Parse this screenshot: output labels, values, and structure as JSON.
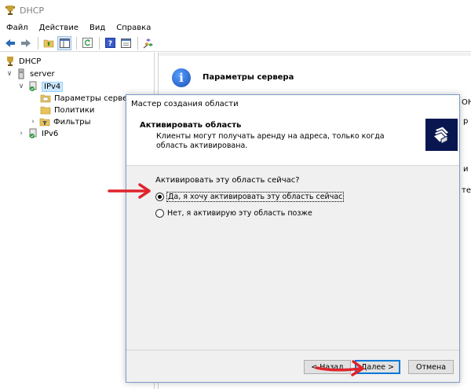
{
  "window": {
    "title": "DHCP",
    "icon": "dhcp-trophy-icon"
  },
  "menubar": {
    "items": [
      "Файл",
      "Действие",
      "Вид",
      "Справка"
    ]
  },
  "toolbar": {
    "buttons": [
      "back-arrow-icon",
      "forward-arrow-icon",
      "up-folder-icon",
      "show-hide-tree-icon",
      "refresh-icon",
      "help-icon",
      "properties-icon",
      "dhcp-action-icon"
    ]
  },
  "tree": {
    "root": "DHCP",
    "server": "server",
    "ipv4": "IPv4",
    "server_options": "Параметры сервера",
    "policies": "Политики",
    "filters": "Фильтры",
    "ipv6": "IPv6"
  },
  "right_pane": {
    "heading": "Параметры сервера",
    "clipped_1": "ОНС",
    "clipped_2": "р",
    "clipped_3": "и",
    "clipped_4": "те."
  },
  "wizard": {
    "title": "Мастер создания области",
    "header_title": "Активировать область",
    "header_desc": "Клиенты могут получать аренду на адреса, только когда область активирована.",
    "question": "Активировать эту область сейчас?",
    "option_yes": "Да, я хочу активировать эту область сейчас",
    "option_no": "Нет, я активирую эту область позже",
    "selected_option": "yes",
    "back_label": "< Назад",
    "next_label": "Далее >",
    "cancel_label": "Отмена"
  },
  "colors": {
    "annotation": "#e0242c",
    "selection": "#cce8ff",
    "accent": "#0078d7"
  }
}
